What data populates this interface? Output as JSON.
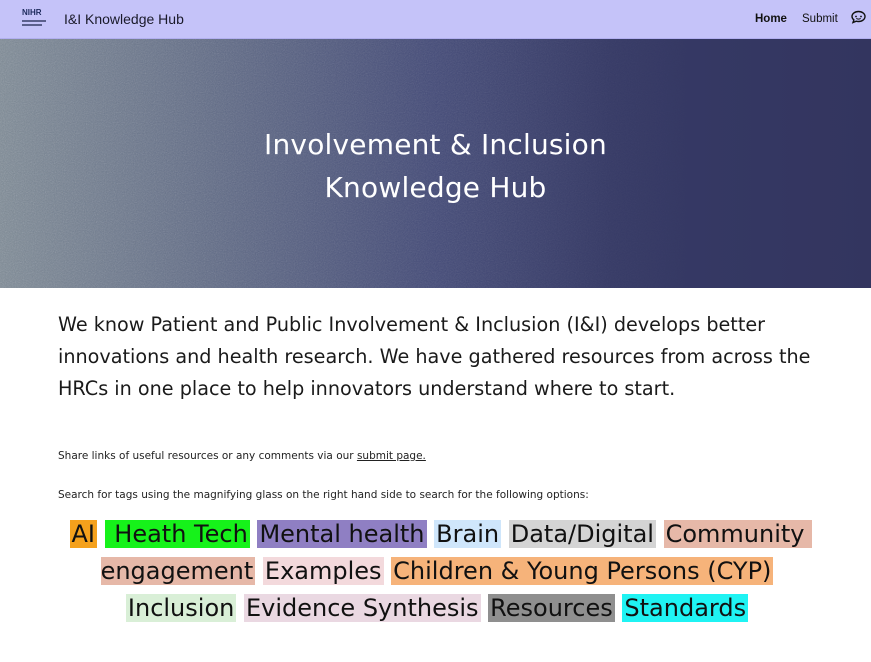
{
  "header": {
    "logo_text": "NIHR",
    "site_title": "I&I Knowledge Hub",
    "nav": {
      "home": "Home",
      "submit": "Submit"
    },
    "icon": "chat-bubble-icon"
  },
  "hero": {
    "title_line1": "Involvement & Inclusion",
    "title_line2": "Knowledge Hub"
  },
  "intro": "We know Patient and Public Involvement & Inclusion (I&I) develops better innovations and health research. We have gathered resources from across the HRCs in one place to help innovators understand where to start.",
  "share": {
    "text": "Share links of useful resources or any comments via our ",
    "link": "submit page."
  },
  "search_note": "Search for tags using the magnifying glass on the right hand side to search for the following options:",
  "tags": [
    {
      "label": "AI",
      "color": "#f5a11c"
    },
    {
      "label": " Heath Tech",
      "color": "#16f21a"
    },
    {
      "label": "Mental health",
      "color": "#8f7fc3"
    },
    {
      "label": "Brain",
      "color": "#cfe6fb"
    },
    {
      "label": "Data/Digital",
      "color": "#d4d4d4"
    },
    {
      "label": "Community engagement",
      "color": "#e6b8a8"
    },
    {
      "label": "Examples",
      "color": "#f3d9dc"
    },
    {
      "label": "Children & Young Persons (CYP)",
      "color": "#f6b37a"
    },
    {
      "label": "Inclusion",
      "color": "#d9efd7"
    },
    {
      "label": "Evidence Synthesis",
      "color": "#ead8e2"
    },
    {
      "label": "Resources",
      "color": "#8f8f8f"
    },
    {
      "label": "Standards",
      "color": "#1ff3f3"
    }
  ]
}
